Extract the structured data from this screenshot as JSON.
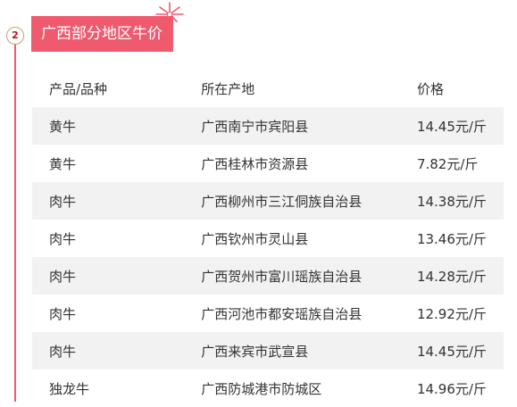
{
  "section": {
    "number": "2",
    "title": "广西部分地区牛价"
  },
  "table": {
    "headers": [
      "产品/品种",
      "所在产地",
      "价格"
    ],
    "rows": [
      {
        "product": "黄牛",
        "origin": "广西南宁市宾阳县",
        "price": "14.45元/斤"
      },
      {
        "product": "黄牛",
        "origin": "广西桂林市资源县",
        "price": "7.82元/斤"
      },
      {
        "product": "肉牛",
        "origin": "广西柳州市三江侗族自治县",
        "price": "14.38元/斤"
      },
      {
        "product": "肉牛",
        "origin": "广西钦州市灵山县",
        "price": "13.46元/斤"
      },
      {
        "product": "肉牛",
        "origin": "广西贺州市富川瑶族自治县",
        "price": "14.28元/斤"
      },
      {
        "product": "肉牛",
        "origin": "广西河池市都安瑶族自治县",
        "price": "12.92元/斤"
      },
      {
        "product": "肉牛",
        "origin": "广西来宾市武宣县",
        "price": "14.45元/斤"
      },
      {
        "product": "独龙牛",
        "origin": "广西防城港市防城区",
        "price": "14.96元/斤"
      }
    ]
  },
  "colors": {
    "accent": "#f05a6e",
    "row_shade": "#f2f2f2",
    "text": "#333333"
  },
  "icons": {
    "badge_decoration": "firework-icon"
  }
}
